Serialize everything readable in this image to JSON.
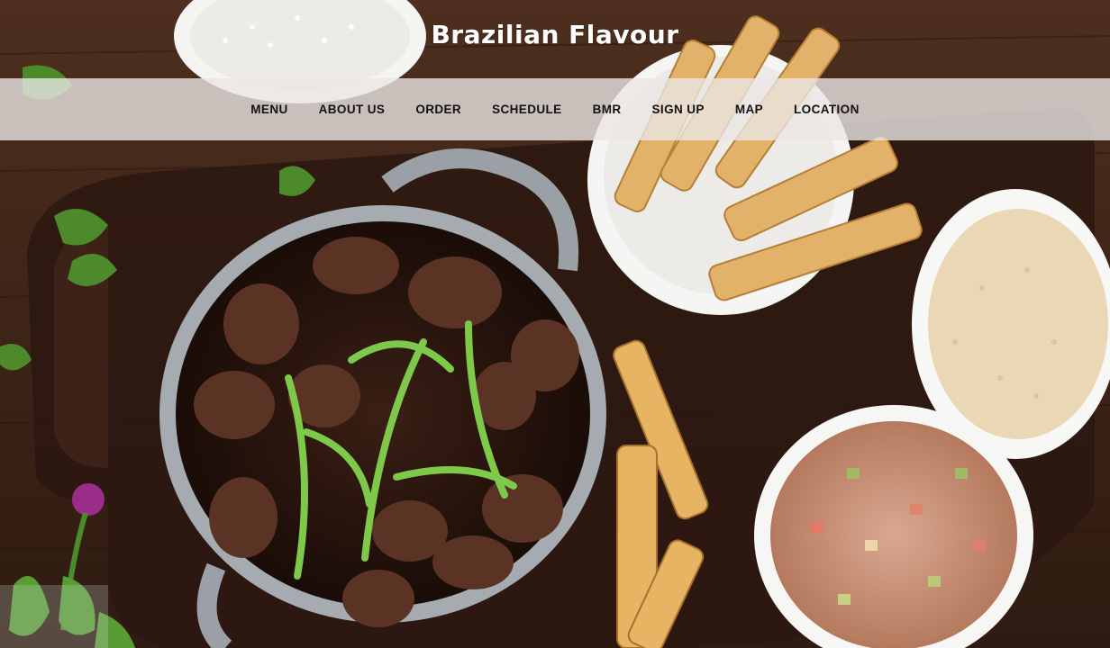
{
  "site": {
    "title": "Brazilian Flavour"
  },
  "nav": {
    "items": [
      {
        "label": "MENU"
      },
      {
        "label": "ABOUT US"
      },
      {
        "label": "ORDER"
      },
      {
        "label": "SCHEDULE"
      },
      {
        "label": "BMR"
      },
      {
        "label": "SIGN UP"
      },
      {
        "label": "MAP"
      },
      {
        "label": "LOCATION"
      }
    ]
  },
  "colors": {
    "title_text": "#ffffff",
    "nav_text": "#111111",
    "nav_background": "rgba(235,230,228,0.80)",
    "wood": "#4a2c1c"
  }
}
